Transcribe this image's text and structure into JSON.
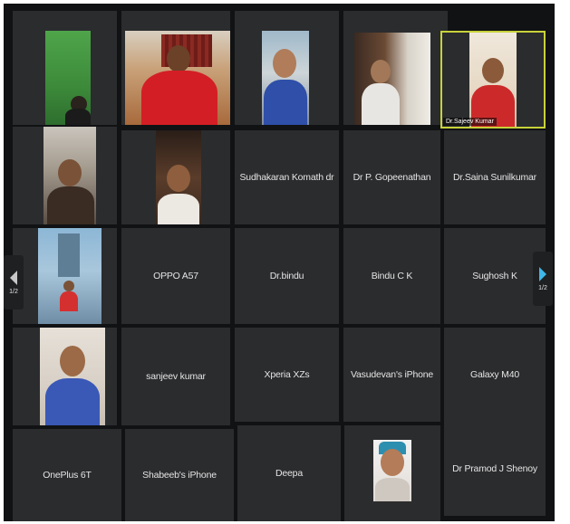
{
  "participants": [
    {
      "name": "",
      "video": true
    },
    {
      "name": "",
      "video": true
    },
    {
      "name": "",
      "video": true
    },
    {
      "name": "",
      "video": true
    },
    {
      "name": "Dr.Sajeev Kumar",
      "video": true,
      "active_speaker": true
    },
    {
      "name": "",
      "video": true
    },
    {
      "name": "",
      "video": true
    },
    {
      "name": "Sudhakaran Komath dr",
      "video": false
    },
    {
      "name": "Dr P. Gopeenathan",
      "video": false
    },
    {
      "name": "Dr.Saina Sunilkumar",
      "video": false
    },
    {
      "name": "",
      "video": true
    },
    {
      "name": "OPPO A57",
      "video": false
    },
    {
      "name": "Dr.bindu",
      "video": false
    },
    {
      "name": "Bindu C K",
      "video": false
    },
    {
      "name": "Sughosh K",
      "video": false
    },
    {
      "name": "",
      "video": true
    },
    {
      "name": "sanjeev kumar",
      "video": false
    },
    {
      "name": "Xperia XZs",
      "video": false
    },
    {
      "name": "Vasudevan's iPhone",
      "video": false
    },
    {
      "name": "Galaxy M40",
      "video": false
    },
    {
      "name": "OnePlus 6T",
      "video": false
    },
    {
      "name": "Shabeeb's iPhone",
      "video": false
    },
    {
      "name": "Deepa",
      "video": false
    },
    {
      "name": "",
      "video": true
    },
    {
      "name": "Dr Pramod J Shenoy",
      "video": false
    }
  ],
  "pagination": {
    "prev_label": "1/2",
    "next_label": "1/2"
  },
  "colors": {
    "tile": "#2b2c2e",
    "background": "#111214",
    "active_border": "#c8d23a",
    "next_arrow": "#3fb7e8"
  },
  "icons": {
    "prev": "triangle-left-icon",
    "next": "triangle-right-icon"
  }
}
